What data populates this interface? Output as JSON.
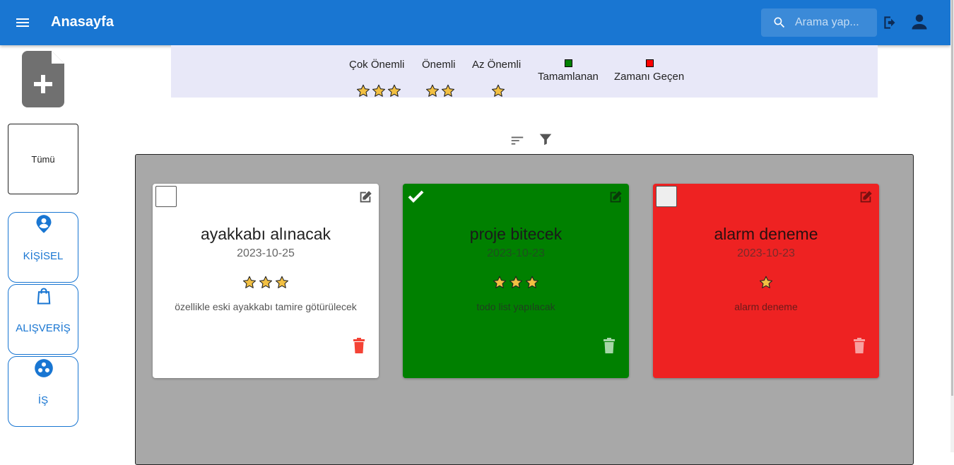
{
  "header": {
    "title": "Anasayfa",
    "search_placeholder": "Arama yap...",
    "icons": [
      "menu-icon",
      "search-icon",
      "logout-icon",
      "account-icon"
    ]
  },
  "sidebar": {
    "add_icon": "note-add-icon",
    "all_label": "Tümü",
    "categories": [
      {
        "label": "KİŞİSEL",
        "icon": "person-pin-icon"
      },
      {
        "label": "ALIŞVERİŞ",
        "icon": "shopping-bag-icon"
      },
      {
        "label": "İŞ",
        "icon": "workspaces-icon"
      }
    ]
  },
  "legend": {
    "priorities": [
      {
        "label": "Çok Önemli",
        "stars": 3
      },
      {
        "label": "Önemli",
        "stars": 2
      },
      {
        "label": "Az Önemli",
        "stars": 1
      }
    ],
    "statuses": [
      {
        "label": "Tamamlanan",
        "color": "#008000"
      },
      {
        "label": "Zamanı Geçen",
        "color": "#ff0000"
      }
    ]
  },
  "toolbar": {
    "icons": [
      "sort-icon",
      "filter-icon"
    ]
  },
  "notes": [
    {
      "title": "ayakkabı alınacak",
      "date": "2023-10-25",
      "stars": 3,
      "description": "özellikle eski ayakkabı tamire götürülecek",
      "completed": false,
      "bg": "#ffffff"
    },
    {
      "title": "proje bitecek",
      "date": "2023-10-23",
      "stars": 3,
      "description": "todo list yapılacak",
      "completed": true,
      "bg": "#008000"
    },
    {
      "title": "alarm deneme",
      "date": "2023-10-23",
      "stars": 1,
      "description": "alarm deneme",
      "completed": false,
      "bg": "#ee2222"
    }
  ],
  "colors": {
    "appbar": "#1976d2",
    "legend_bg": "#e8e8f8",
    "board_bg": "#a8a8a8",
    "star": "#f2c043",
    "delete": "#f44336"
  }
}
